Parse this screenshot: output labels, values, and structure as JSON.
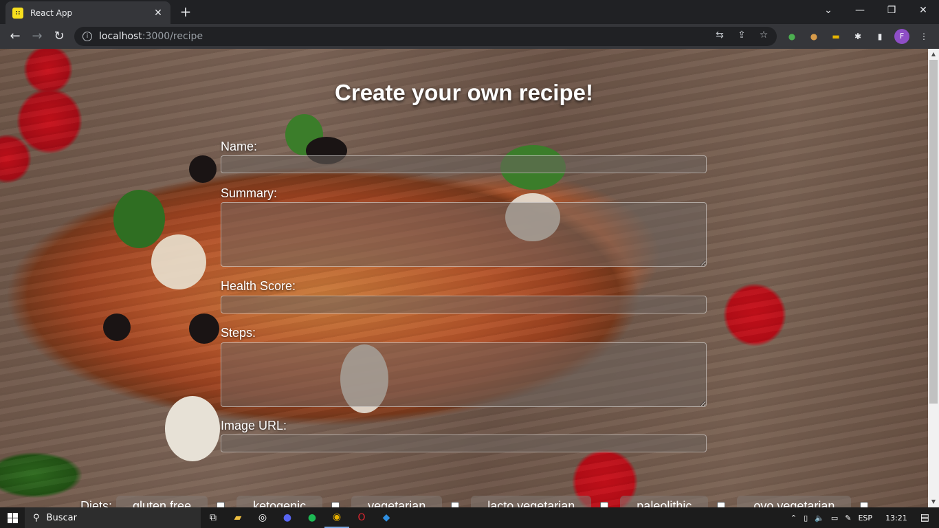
{
  "browser": {
    "tab_title": "React App",
    "tab_favicon": "react-app-favicon",
    "url_host": "localhost",
    "url_path": ":3000/recipe",
    "profile_initial": "F"
  },
  "page": {
    "heading": "Create your own recipe!",
    "fields": {
      "name_label": "Name:",
      "name_value": "",
      "summary_label": "Summary:",
      "summary_value": "",
      "health_label": "Health Score:",
      "health_value": "",
      "steps_label": "Steps:",
      "steps_value": "",
      "image_label": "Image URL:",
      "image_value": ""
    },
    "diets_label": "Diets:",
    "diets": [
      {
        "label": "gluten free",
        "checked": false
      },
      {
        "label": "ketogenic",
        "checked": false
      },
      {
        "label": "vegetarian",
        "checked": false
      },
      {
        "label": "lacto vegetarian",
        "checked": false
      },
      {
        "label": "paleolithic",
        "checked": false
      },
      {
        "label": "ovo vegetarian",
        "checked": false
      }
    ]
  },
  "taskbar": {
    "search_placeholder": "Buscar",
    "language": "ESP",
    "time": "13:21"
  }
}
